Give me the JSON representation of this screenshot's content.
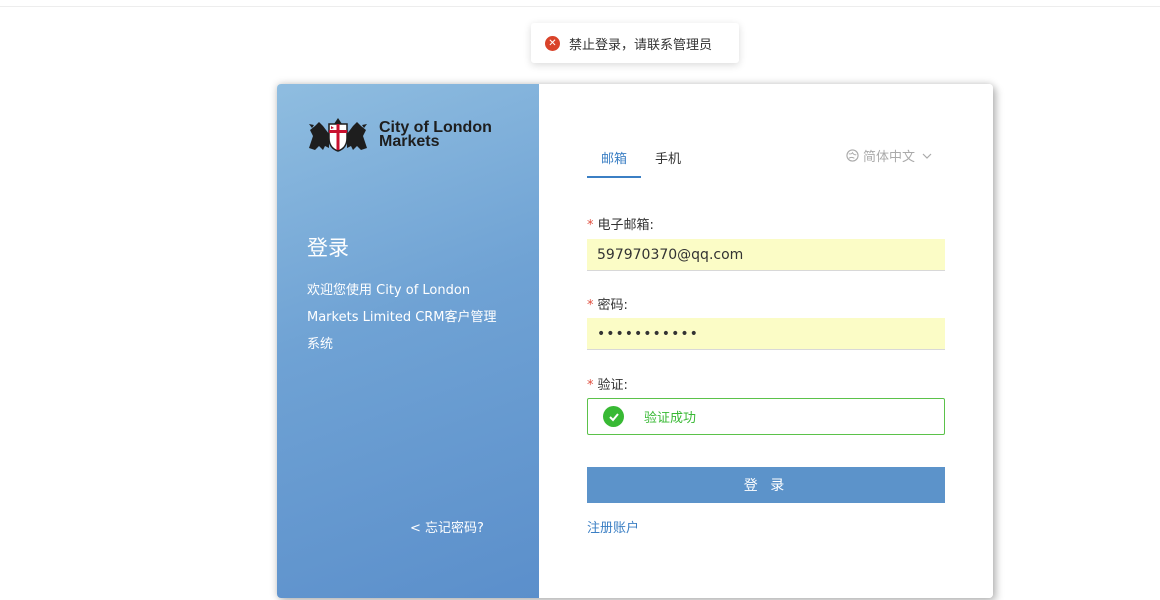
{
  "toast": {
    "icon": "close-circle-icon",
    "message": "禁止登录，请联系管理员",
    "color": "#d9432a"
  },
  "brand": {
    "logo_line1": "City of London",
    "logo_line2": "Markets"
  },
  "left": {
    "title": "登录",
    "description": "欢迎您使用 City of London Markets Limited CRM客户管理系统",
    "forgot_password": "< 忘记密码?"
  },
  "tabs": [
    {
      "label": "邮箱",
      "active": true
    },
    {
      "label": "手机",
      "active": false
    }
  ],
  "language": {
    "icon": "globe-icon",
    "selected": "简体中文"
  },
  "form": {
    "email_label": "电子邮箱:",
    "email_value": "597970370@qq.com",
    "password_label": "密码:",
    "password_value": "•••••••••••",
    "verify_label": "验证:",
    "verify_status": "验证成功",
    "required_mark": "*",
    "submit_label": "登 录",
    "register_link": "注册账户"
  },
  "colors": {
    "accent": "#3b7fc4",
    "button": "#5c93ca",
    "success": "#38b934",
    "required": "#e04b3b",
    "autofill": "#fbfcc6"
  }
}
